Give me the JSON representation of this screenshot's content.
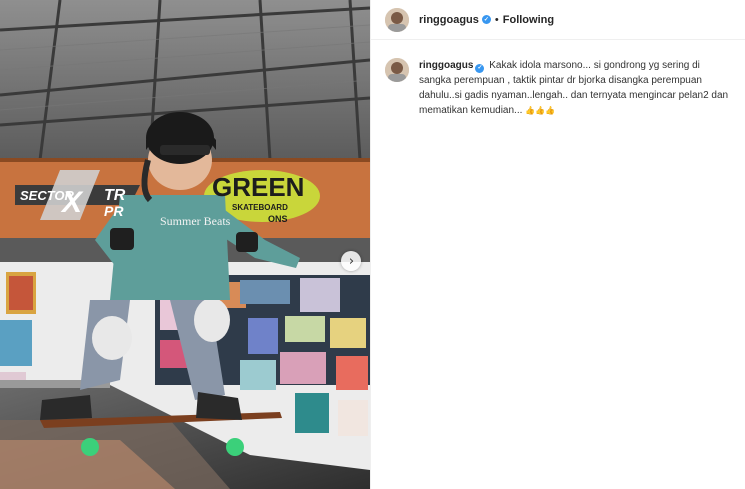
{
  "post": {
    "username": "ringgoagus",
    "separator": "•",
    "follow_label": "Following",
    "verified_glyph": "✓"
  },
  "media": {
    "description_icon": "photo-carousel",
    "next_glyph": "›",
    "banner_left": "SECTOR",
    "banner_x": "X",
    "banner_tr": "TR",
    "banner_pr": "PR",
    "banner_right": "GREEN",
    "banner_sub": "SKATEBOARD",
    "banner_sub2": "ONS",
    "shirt_text": "Summer Beats"
  },
  "caption": {
    "username": "ringgoagus",
    "verified_glyph": "✓",
    "text": "Kakak idola marsono... si gondrong yg sering di sangka perempuan , taktik pintar dr bjorka disangka perempuan dahulu..si gadis nyaman..lengah.. dan ternyata mengincar pelan2 dan mematikan kemudian...",
    "emojis": "👍👍👍"
  },
  "colors": {
    "accent": "#3897f0",
    "banner": "#c8733f",
    "text": "#262626"
  }
}
